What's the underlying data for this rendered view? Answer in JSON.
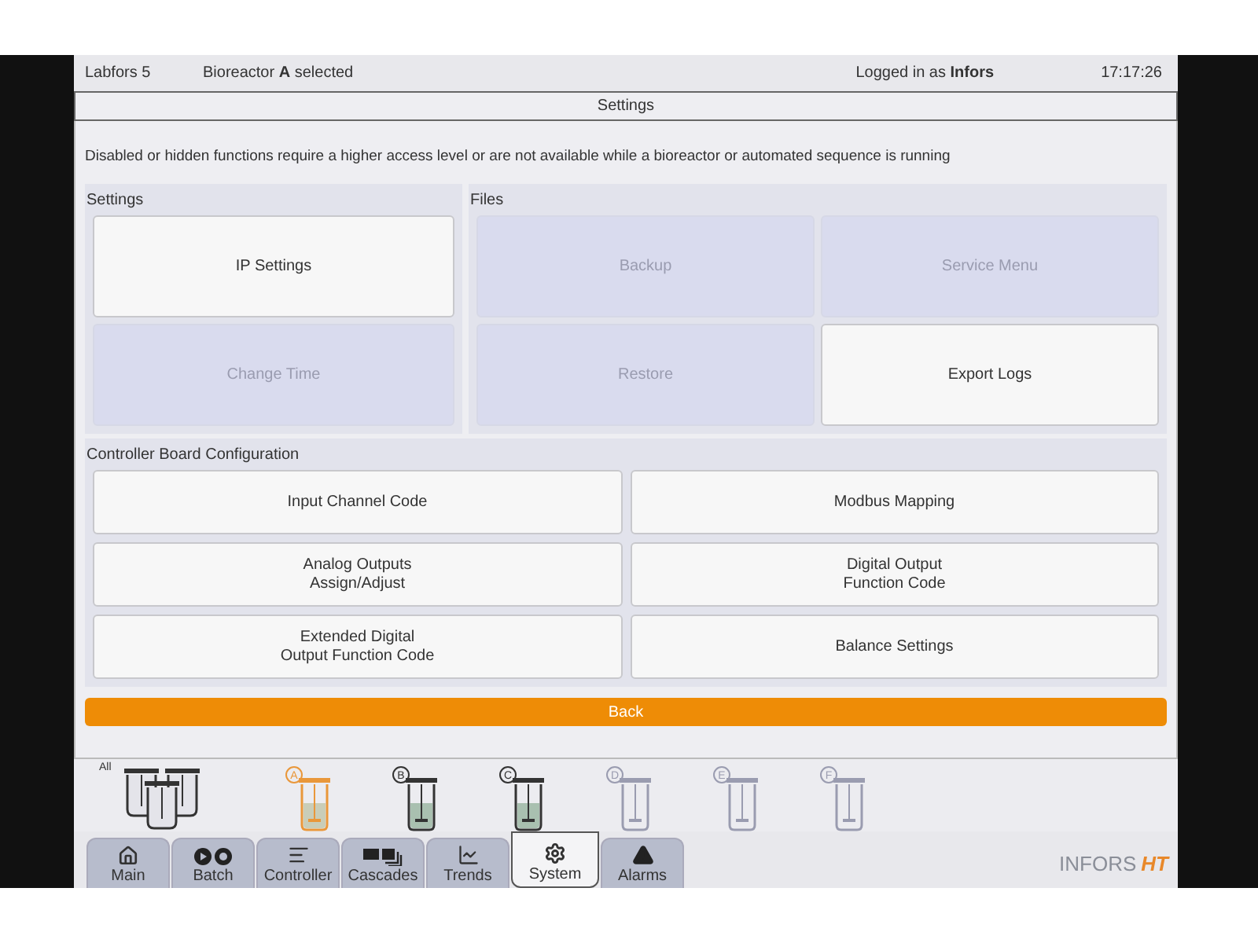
{
  "header": {
    "device": "Labfors 5",
    "selection": "Bioreactor **A** selected",
    "user": "Logged in as **Infors**",
    "time": "17:17:26"
  },
  "title": "Settings",
  "notice": "Disabled or hidden functions require a higher access level or are not available while a bioreactor or automated sequence is running",
  "settings": {
    "heading": "Settings",
    "buttons": [
      {
        "label": "IP Settings",
        "disabled": false
      },
      {
        "label": "Change Time",
        "disabled": true
      }
    ]
  },
  "files": {
    "heading": "Files",
    "buttons": [
      {
        "label": "Backup",
        "disabled": true
      },
      {
        "label": "Service Menu",
        "disabled": true
      },
      {
        "label": "Restore",
        "disabled": true
      },
      {
        "label": "Export Logs",
        "disabled": false
      }
    ]
  },
  "controller_board": {
    "heading": "Controller Board Configuration",
    "buttons": [
      {
        "label": "Input Channel Code"
      },
      {
        "label": "Modbus Mapping"
      },
      {
        "label": "Analog Outputs\nAssign/Adjust"
      },
      {
        "label": "Digital Output\nFunction Code"
      },
      {
        "label": "Extended Digital\nOutput Function Code"
      },
      {
        "label": "Balance Settings"
      }
    ]
  },
  "back_button": "Back",
  "vessels": {
    "all_label": "All",
    "items": [
      {
        "label": "A",
        "selected": true,
        "filled": true,
        "active": true
      },
      {
        "label": "B",
        "selected": false,
        "filled": true,
        "active": true
      },
      {
        "label": "C",
        "selected": false,
        "filled": true,
        "active": true
      },
      {
        "label": "D",
        "selected": false,
        "filled": false,
        "active": false
      },
      {
        "label": "E",
        "selected": false,
        "filled": false,
        "active": false
      },
      {
        "label": "F",
        "selected": false,
        "filled": false,
        "active": false
      }
    ]
  },
  "tabs": [
    {
      "label": "Main",
      "kind": "home",
      "selected": false
    },
    {
      "label": "Batch",
      "kind": "batch",
      "selected": false
    },
    {
      "label": "Controller",
      "kind": "controller",
      "selected": false
    },
    {
      "label": "Cascades",
      "kind": "cascades",
      "selected": false
    },
    {
      "label": "Trends",
      "kind": "trends",
      "selected": false
    },
    {
      "label": "System",
      "kind": "system",
      "selected": true
    },
    {
      "label": "Alarms",
      "kind": "alarms",
      "selected": false
    }
  ],
  "logo": {
    "text": "INFORS",
    "mark": "HT"
  }
}
